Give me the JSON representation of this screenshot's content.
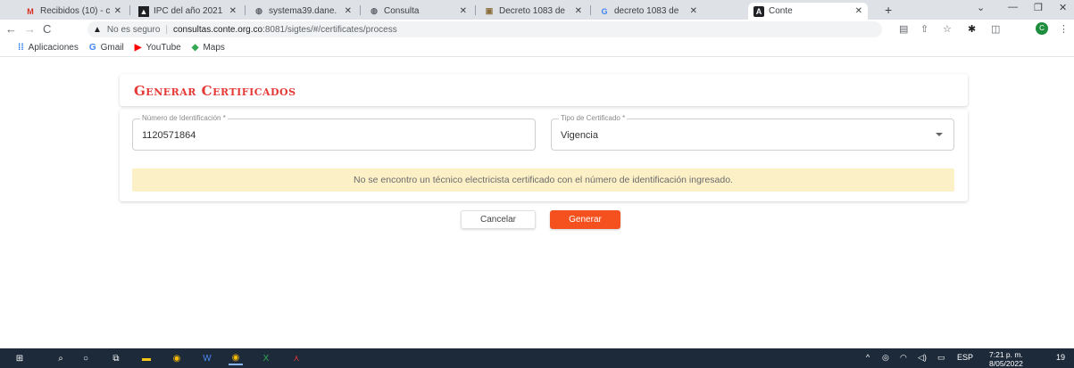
{
  "browser": {
    "tabs": [
      {
        "title": "Recibidos (10) - c",
        "favicon": "gmail-icon"
      },
      {
        "title": "IPC del año 2021",
        "favicon": "dane-icon"
      },
      {
        "title": "systema39.dane.",
        "favicon": "globe-icon"
      },
      {
        "title": "Consulta",
        "favicon": "globe-icon"
      },
      {
        "title": "Decreto 1083 de",
        "favicon": "document-icon"
      },
      {
        "title": "decreto 1083 de",
        "favicon": "google-icon"
      },
      {
        "title": "Conte",
        "favicon": "angular-icon"
      }
    ],
    "new_tab": "+",
    "address": {
      "security": "No es seguro",
      "host": "consultas.conte.org.co",
      "path": ":8081/sigtes/#/certificates/process"
    },
    "profile_initial": "C",
    "bookmarks": [
      {
        "label": "Aplicaciones",
        "icon": "apps-grid-icon"
      },
      {
        "label": "Gmail",
        "icon": "google-icon"
      },
      {
        "label": "YouTube",
        "icon": "youtube-icon"
      },
      {
        "label": "Maps",
        "icon": "maps-icon"
      }
    ]
  },
  "page": {
    "title": "Generar Certificados",
    "id_field": {
      "label": "Número de Identificación *",
      "value": "1120571864"
    },
    "type_field": {
      "label": "Tipo de Certificado *",
      "value": "Vigencia"
    },
    "alert": "No se encontro un técnico electricista certificado con el número de identificación ingresado.",
    "cancel_label": "Cancelar",
    "generate_label": "Generar",
    "colors": {
      "accent": "#f4511e",
      "title": "#e53935",
      "alert_bg": "#fcf0c7"
    }
  },
  "taskbar": {
    "language": "ESP",
    "time": "7:21 p. m.",
    "date": "8/05/2022",
    "notifications": "19"
  }
}
